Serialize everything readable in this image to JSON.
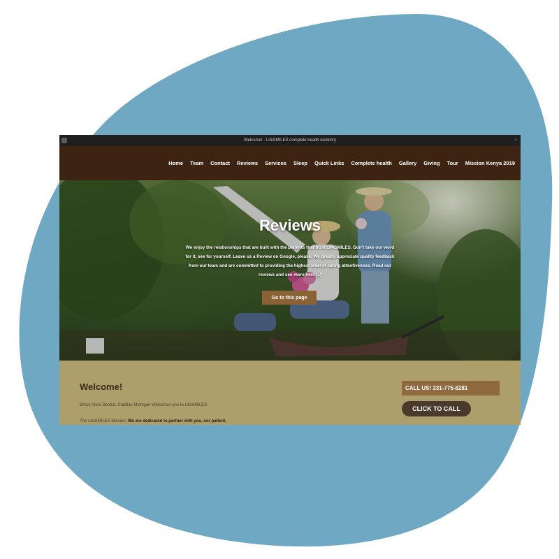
{
  "colors": {
    "blob": "#6fa8c3",
    "nav_bg": "#3d2412",
    "content_bg": "#ac9f6c",
    "hero_button": "#8a6236",
    "call_bar": "#8f6a3e",
    "click_button": "#4a3a2c"
  },
  "window": {
    "title": "Welcome! - LifeSMILES complete health dentistry"
  },
  "nav": {
    "items": [
      "Home",
      "Team",
      "Contact",
      "Reviews",
      "Services",
      "Sleep",
      "Quick Links",
      "Complete health",
      "Gallery",
      "Giving",
      "Tour",
      "Mission Kenya 2019"
    ]
  },
  "hero": {
    "title": "Reviews",
    "text": "We enjoy the relationships that are built with the patients that trust LifeSMILES. Don't take our word for it, see for yourself. Leave us a Review on Google, please. We greatly appreciate quality feedback from our team and are committed to providing the highest level of caring attentiveness. Read our reviews and see more here (..)",
    "button": "Go to this page"
  },
  "content": {
    "heading": "Welcome!",
    "line1": "Brock Anne Dentist, Cadillac Michigan Welcomes you to LifeSMILES.",
    "line2_prefix": "The LifeSMILES Mission:",
    "line2_bold": "We are dedicated to partner with you, our patient,",
    "call_label": "CALL US! 231-775-8281",
    "click_to_call": "CLICK TO CALL"
  }
}
